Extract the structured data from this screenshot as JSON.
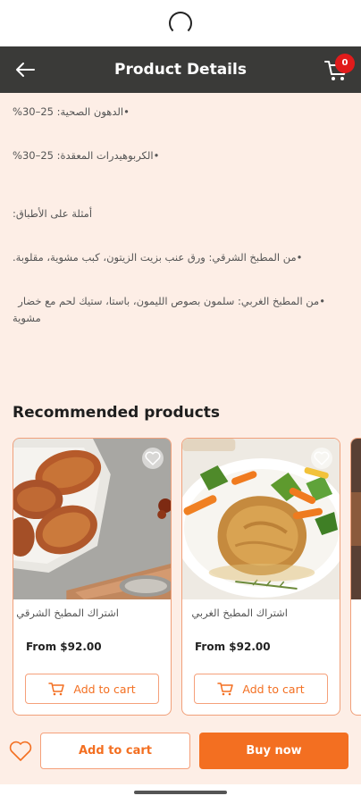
{
  "header": {
    "title": "Product Details",
    "cart_count": "0"
  },
  "description": {
    "lines": [
      "•الدهون الصحية: 25–30%",
      "•الكربوهيدرات المعقدة: 25–30%",
      "أمثلة على الأطباق:",
      "•من المطبخ الشرقي: ورق عنب بزيت الزيتون، كبب مشوية، مقلوبة.",
      "•من المطبخ الغربي: سلمون بصوص الليمون، باستا، ستيك لحم مع خضار",
      "مشوية"
    ]
  },
  "recommended": {
    "title": "Recommended products",
    "products": [
      {
        "name": "اشتراك المطبخ الشرقي",
        "price": "From $92.00",
        "cart_label": "Add to cart"
      },
      {
        "name": "اشتراك المطبخ الغربي",
        "price": "From $92.00",
        "cart_label": "Add to cart"
      }
    ]
  },
  "bottom_bar": {
    "add_to_cart": "Add to cart",
    "buy_now": "Buy now"
  },
  "colors": {
    "accent": "#f36f21",
    "header_bg": "#3a3a38",
    "page_bg": "#fdeee6",
    "badge": "#e11b1b"
  }
}
